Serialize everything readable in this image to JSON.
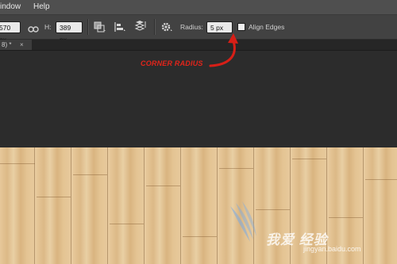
{
  "menubar": {
    "items": [
      "indow",
      "Help"
    ]
  },
  "options_bar": {
    "width_value": "570 px",
    "height_label": "H:",
    "height_value": "389 px",
    "radius_label": "Radius:",
    "radius_value": "5 px",
    "align_edges_label": "Align Edges",
    "align_edges_checked": false,
    "icons": [
      "link-icon",
      "path-operations-icon",
      "path-alignment-icon",
      "path-arrangement-icon",
      "gear-icon"
    ]
  },
  "tabs": [
    {
      "label": "8) *",
      "close": "×"
    }
  ],
  "annotation": {
    "text": "CORNER RADIUS",
    "color": "#e3241a"
  },
  "watermark": {
    "text": "我爱 经验",
    "url": "jingyan.baidu.com"
  }
}
